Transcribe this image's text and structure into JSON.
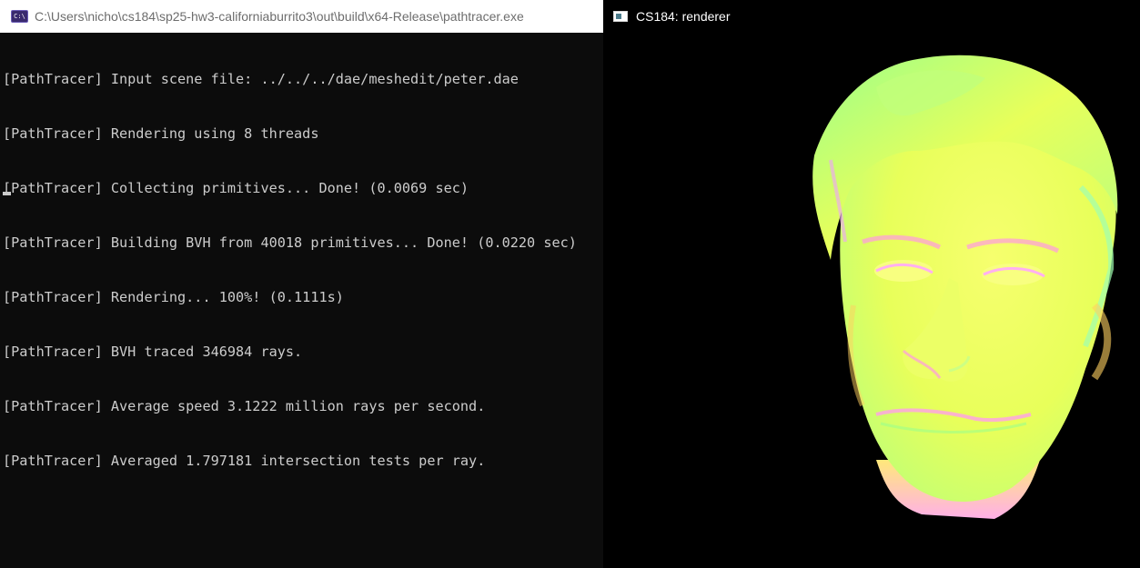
{
  "console": {
    "title": "C:\\Users\\nicho\\cs184\\sp25-hw3-californiaburrito3\\out\\build\\x64-Release\\pathtracer.exe",
    "icon_text": "C:\\",
    "lines": [
      "[PathTracer] Input scene file: ../../../dae/meshedit/peter.dae",
      "[PathTracer] Rendering using 8 threads",
      "[PathTracer] Collecting primitives... Done! (0.0069 sec)",
      "[PathTracer] Building BVH from 40018 primitives... Done! (0.0220 sec)",
      "[PathTracer] Rendering... 100%! (0.1111s)",
      "[PathTracer] BVH traced 346984 rays.",
      "[PathTracer] Average speed 3.1222 million rays per second.",
      "[PathTracer] Averaged 1.797181 intersection tests per ray."
    ]
  },
  "renderer": {
    "title": "CS184: renderer",
    "icon": "app-window-icon",
    "image": "normal-shaded-head-render",
    "colors": {
      "background": "#000000",
      "skin_main": "#e8ff5a",
      "skin_green": "#9cff8a",
      "skin_pink": "#ff9ae0",
      "skin_orange": "#ffd060"
    }
  }
}
